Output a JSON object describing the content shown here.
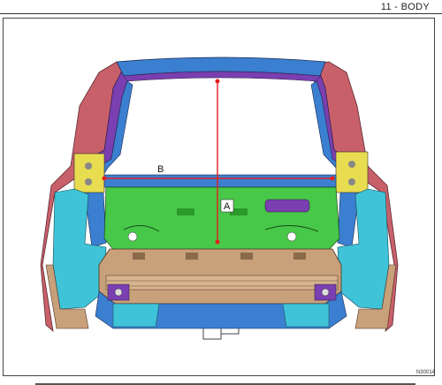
{
  "header": {
    "section": "11 - BODY"
  },
  "figure": {
    "code": "N30014",
    "dimension_labels": {
      "a": "A",
      "b": "B"
    }
  },
  "colors": {
    "red_frame": "#c8606a",
    "purple": "#7a3fb0",
    "blue": "#3b7fd0",
    "cyan": "#3fc3d8",
    "green": "#48c848",
    "tan": "#c8a07a",
    "yellow": "#e8dc50",
    "dimension_line": "#e02020"
  }
}
